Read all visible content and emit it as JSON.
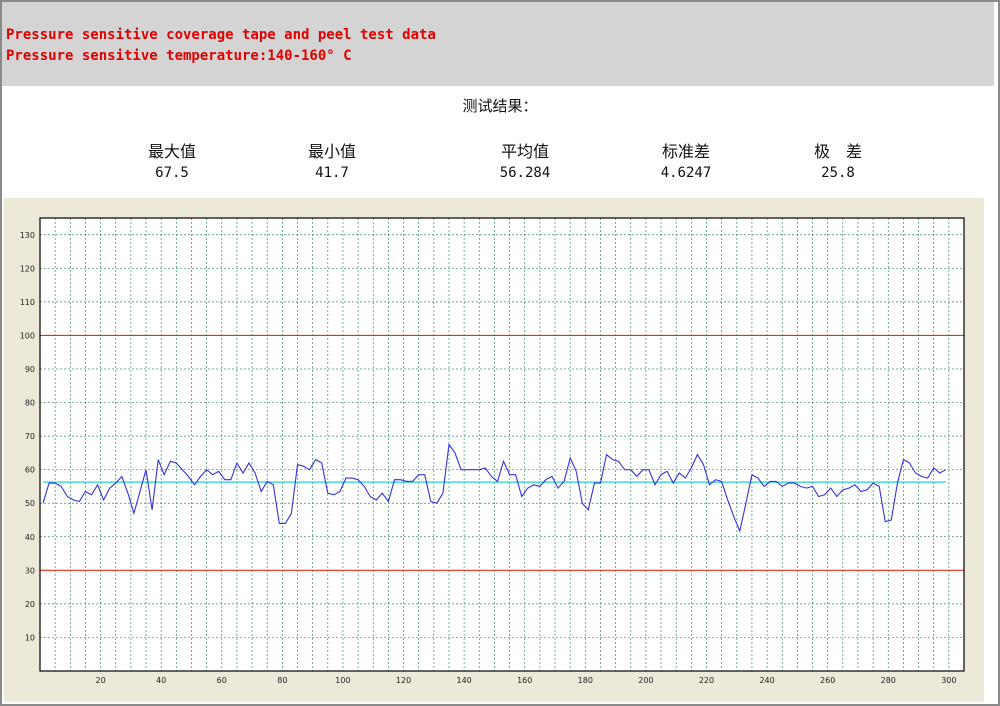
{
  "header": {
    "line1": "Pressure sensitive coverage tape and peel test data",
    "line2": "Pressure sensitive temperature:140-160° C"
  },
  "results": {
    "title": "测试结果：",
    "stats": [
      {
        "label": "最大值",
        "value": "67.5"
      },
      {
        "label": "最小值",
        "value": "41.7"
      },
      {
        "label": "平均值",
        "value": "56.284"
      },
      {
        "label": "标准差",
        "value": "4.6247"
      },
      {
        "label": "极　差",
        "value": "25.8"
      }
    ]
  },
  "chart_data": {
    "type": "line",
    "xlim": [
      0,
      305
    ],
    "ylim": [
      0,
      135
    ],
    "x_ticks": [
      20,
      40,
      60,
      80,
      100,
      120,
      140,
      160,
      180,
      200,
      220,
      240,
      260,
      280,
      300
    ],
    "y_ticks": [
      10,
      20,
      30,
      40,
      50,
      60,
      70,
      80,
      90,
      100,
      110,
      120,
      130
    ],
    "grid": true,
    "upper_limit": 100,
    "lower_limit": 30,
    "mean": 56.284,
    "colors": {
      "series": "#3333dd",
      "limits": "#e03020",
      "mean": "#20d0d0",
      "grid": "#3a8a6a"
    },
    "series": [
      {
        "x": [
          1,
          3,
          5,
          7,
          9,
          11,
          13,
          15,
          17,
          19,
          21,
          23,
          25,
          27,
          29,
          31,
          33,
          35,
          37,
          39,
          41,
          43,
          45,
          47,
          49,
          51,
          53,
          55,
          57,
          59,
          61,
          63,
          65,
          67,
          69,
          71,
          73,
          75,
          77,
          79,
          81,
          83,
          85,
          87,
          89,
          91,
          93,
          95,
          97,
          99,
          101,
          103,
          105,
          107,
          109,
          111,
          113,
          115,
          117,
          119,
          121,
          123,
          125,
          127,
          129,
          131,
          133,
          135,
          137,
          139,
          141,
          143,
          145,
          147,
          149,
          151,
          153,
          155,
          157,
          159,
          161,
          163,
          165,
          167,
          169,
          171,
          173,
          175,
          177,
          179,
          181,
          183,
          185,
          187,
          189,
          191,
          193,
          195,
          197,
          199,
          201,
          203,
          205,
          207,
          209,
          211,
          213,
          215,
          217,
          219,
          221,
          223,
          225,
          227,
          229,
          231,
          233,
          235,
          237,
          239,
          241,
          243,
          245,
          247,
          249,
          251,
          253,
          255,
          257,
          259,
          261,
          263,
          265,
          267,
          269,
          271,
          273,
          275,
          277,
          279,
          281,
          283,
          285,
          287,
          289,
          291,
          293,
          295,
          297,
          299
        ],
        "values": [
          50,
          56,
          56,
          55,
          52,
          51,
          50.5,
          53.5,
          52.5,
          55.5,
          51,
          54.5,
          56,
          58,
          53,
          47,
          53.5,
          60,
          48,
          63,
          58.5,
          62.5,
          62,
          60,
          58,
          55.5,
          58,
          60,
          58.5,
          59.5,
          57,
          57,
          62,
          59,
          62,
          59,
          53.5,
          56.5,
          55.5,
          44,
          44,
          47,
          61.5,
          61,
          60,
          63,
          62,
          53,
          52.5,
          53.5,
          57.5,
          57.5,
          57,
          55,
          52,
          51,
          53,
          50.5,
          57,
          57,
          56.5,
          56.5,
          58.5,
          58.5,
          50.5,
          50,
          53,
          67.5,
          65,
          60,
          60,
          60,
          60,
          60.5,
          58,
          56.5,
          62.5,
          58.5,
          58.5,
          52,
          54.5,
          55.5,
          55,
          57,
          58,
          54.5,
          56.5,
          63.5,
          59.5,
          50,
          48,
          56,
          56,
          64.5,
          63,
          62.5,
          60,
          60,
          58,
          60,
          60,
          55.5,
          58.5,
          59.5,
          56,
          59,
          57.5,
          60.5,
          64.5,
          61.5,
          55.5,
          57,
          56.5,
          51,
          46,
          41.7,
          50,
          58.5,
          57.5,
          55,
          56.5,
          56.5,
          55,
          56,
          56,
          55,
          54.5,
          55,
          52,
          52.5,
          54.5,
          52,
          54,
          54.5,
          55.5,
          53.5,
          54,
          56,
          55,
          44.5,
          45,
          56,
          63,
          62,
          59,
          58,
          57.5,
          60.5,
          59,
          60
        ]
      }
    ]
  }
}
